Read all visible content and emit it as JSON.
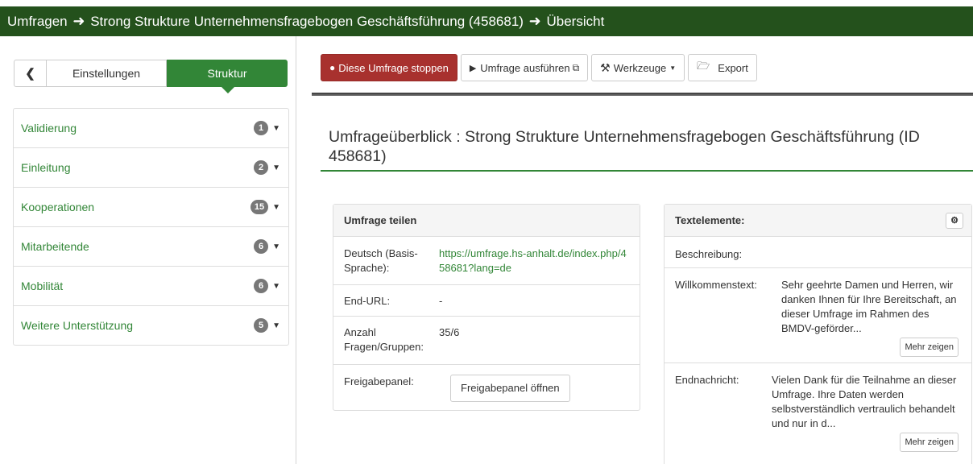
{
  "breadcrumb": {
    "item1": "Umfragen",
    "item2": "Strong Strukture Unternehmensfragebogen Geschäftsführung (458681)",
    "item3": "Übersicht",
    "separator": "🡆"
  },
  "sidebar": {
    "back_icon": "chevron-left",
    "tabs": {
      "settings": "Einstellungen",
      "structure": "Struktur"
    },
    "groups": [
      {
        "label": "Validierung",
        "count": "1"
      },
      {
        "label": "Einleitung",
        "count": "2"
      },
      {
        "label": "Kooperationen",
        "count": "15"
      },
      {
        "label": "Mitarbeitende",
        "count": "6"
      },
      {
        "label": "Mobilität",
        "count": "6"
      },
      {
        "label": "Weitere Unterstützung",
        "count": "5"
      }
    ]
  },
  "toolbar": {
    "stop": "Diese Umfrage stoppen",
    "run": "Umfrage ausführen",
    "tools": "Werkzeuge",
    "export": "Export"
  },
  "overview": {
    "title": "Umfrageüberblick : Strong Strukture Unternehmensfragebogen Geschäftsführung (ID 458681)"
  },
  "share_panel": {
    "heading": "Umfrage teilen",
    "rows": [
      {
        "key": "Deutsch (Basis-Sprache):",
        "value": "https://umfrage.hs-anhalt.de/index.php/458681?lang=de"
      },
      {
        "key": "End-URL:",
        "value": "-"
      },
      {
        "key": "Anzahl Fragen/Gruppen:",
        "value": "35/6"
      },
      {
        "key": "Freigabepanel:",
        "value": "Freigabepanel öffnen"
      }
    ]
  },
  "text_panel": {
    "heading": "Textelemente:",
    "rows": [
      {
        "key": "Beschreibung:",
        "value": ""
      },
      {
        "key": "Willkommenstext:",
        "value": "Sehr geehrte Damen und Herren, wir danken Ihnen für Ihre Bereitschaft, an dieser Umfrage im Rahmen des BMDV-geförder...",
        "more": "Mehr zeigen"
      },
      {
        "key": "Endnachricht:",
        "value": "Vielen Dank für die Teilnahme an dieser Umfrage. Ihre Daten werden selbstverständlich vertraulich behandelt und nur in d...",
        "more": "Mehr zeigen"
      }
    ]
  },
  "colors": {
    "header_bg": "#24511c",
    "accent_green": "#328637",
    "stop_red": "#a8312e",
    "badge_gray": "#777777"
  }
}
